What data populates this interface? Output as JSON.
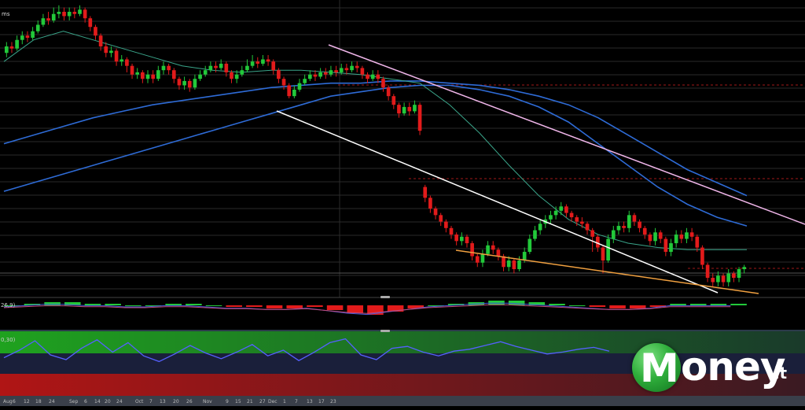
{
  "chart_data": [
    {
      "type": "candlestick",
      "title": "",
      "x_ticks": [
        "Aug",
        "6",
        "12",
        "18",
        "24",
        "Sep",
        "6",
        "14",
        "20",
        "24",
        "Oct",
        "7",
        "13",
        "20",
        "26",
        "Nov",
        "9",
        "15",
        "21",
        "27",
        "Dec",
        "1",
        "7",
        "13",
        "17",
        "23"
      ],
      "y_range": [
        0,
        100
      ],
      "grid": true,
      "candles": [
        {
          "o": 72,
          "c": 75,
          "h": 77,
          "l": 70
        },
        {
          "o": 75,
          "c": 74,
          "h": 77,
          "l": 72
        },
        {
          "o": 74,
          "c": 78,
          "h": 80,
          "l": 73
        },
        {
          "o": 78,
          "c": 80,
          "h": 82,
          "l": 76
        },
        {
          "o": 80,
          "c": 79,
          "h": 82,
          "l": 77
        },
        {
          "o": 79,
          "c": 82,
          "h": 84,
          "l": 78
        },
        {
          "o": 82,
          "c": 85,
          "h": 87,
          "l": 81
        },
        {
          "o": 85,
          "c": 88,
          "h": 90,
          "l": 84
        },
        {
          "o": 88,
          "c": 87,
          "h": 91,
          "l": 85
        },
        {
          "o": 87,
          "c": 90,
          "h": 93,
          "l": 86
        },
        {
          "o": 90,
          "c": 91,
          "h": 94,
          "l": 88
        },
        {
          "o": 91,
          "c": 89,
          "h": 93,
          "l": 87
        },
        {
          "o": 89,
          "c": 91,
          "h": 93,
          "l": 87
        },
        {
          "o": 91,
          "c": 90,
          "h": 93,
          "l": 88
        },
        {
          "o": 90,
          "c": 92,
          "h": 94,
          "l": 89
        },
        {
          "o": 92,
          "c": 88,
          "h": 93,
          "l": 86
        },
        {
          "o": 88,
          "c": 84,
          "h": 89,
          "l": 82
        },
        {
          "o": 84,
          "c": 80,
          "h": 85,
          "l": 78
        },
        {
          "o": 80,
          "c": 75,
          "h": 81,
          "l": 73
        },
        {
          "o": 75,
          "c": 72,
          "h": 77,
          "l": 70
        },
        {
          "o": 72,
          "c": 73,
          "h": 75,
          "l": 70
        },
        {
          "o": 73,
          "c": 68,
          "h": 74,
          "l": 66
        },
        {
          "o": 68,
          "c": 69,
          "h": 71,
          "l": 66
        },
        {
          "o": 69,
          "c": 66,
          "h": 70,
          "l": 63
        },
        {
          "o": 66,
          "c": 62,
          "h": 67,
          "l": 60
        },
        {
          "o": 62,
          "c": 63,
          "h": 65,
          "l": 60
        },
        {
          "o": 63,
          "c": 60,
          "h": 64,
          "l": 58
        },
        {
          "o": 60,
          "c": 62,
          "h": 64,
          "l": 58
        },
        {
          "o": 62,
          "c": 60,
          "h": 64,
          "l": 58
        },
        {
          "o": 60,
          "c": 64,
          "h": 66,
          "l": 59
        },
        {
          "o": 64,
          "c": 66,
          "h": 68,
          "l": 62
        },
        {
          "o": 66,
          "c": 64,
          "h": 67,
          "l": 62
        },
        {
          "o": 64,
          "c": 60,
          "h": 65,
          "l": 58
        },
        {
          "o": 60,
          "c": 57,
          "h": 61,
          "l": 55
        },
        {
          "o": 57,
          "c": 59,
          "h": 61,
          "l": 55
        },
        {
          "o": 59,
          "c": 56,
          "h": 60,
          "l": 54
        },
        {
          "o": 56,
          "c": 60,
          "h": 62,
          "l": 55
        },
        {
          "o": 60,
          "c": 62,
          "h": 64,
          "l": 59
        },
        {
          "o": 62,
          "c": 64,
          "h": 66,
          "l": 61
        },
        {
          "o": 64,
          "c": 66,
          "h": 68,
          "l": 63
        },
        {
          "o": 66,
          "c": 65,
          "h": 68,
          "l": 63
        },
        {
          "o": 65,
          "c": 67,
          "h": 69,
          "l": 64
        },
        {
          "o": 67,
          "c": 63,
          "h": 68,
          "l": 61
        },
        {
          "o": 63,
          "c": 60,
          "h": 64,
          "l": 58
        },
        {
          "o": 60,
          "c": 62,
          "h": 64,
          "l": 58
        },
        {
          "o": 62,
          "c": 64,
          "h": 66,
          "l": 61
        },
        {
          "o": 64,
          "c": 66,
          "h": 69,
          "l": 63
        },
        {
          "o": 66,
          "c": 68,
          "h": 71,
          "l": 65
        },
        {
          "o": 68,
          "c": 67,
          "h": 70,
          "l": 65
        },
        {
          "o": 67,
          "c": 69,
          "h": 71,
          "l": 66
        },
        {
          "o": 69,
          "c": 68,
          "h": 71,
          "l": 66
        },
        {
          "o": 68,
          "c": 64,
          "h": 69,
          "l": 62
        },
        {
          "o": 64,
          "c": 60,
          "h": 65,
          "l": 58
        },
        {
          "o": 60,
          "c": 57,
          "h": 61,
          "l": 55
        },
        {
          "o": 57,
          "c": 52,
          "h": 58,
          "l": 51
        },
        {
          "o": 52,
          "c": 55,
          "h": 57,
          "l": 51
        },
        {
          "o": 55,
          "c": 58,
          "h": 60,
          "l": 54
        },
        {
          "o": 58,
          "c": 60,
          "h": 62,
          "l": 57
        },
        {
          "o": 60,
          "c": 62,
          "h": 64,
          "l": 59
        },
        {
          "o": 62,
          "c": 61,
          "h": 64,
          "l": 59
        },
        {
          "o": 61,
          "c": 63,
          "h": 65,
          "l": 60
        },
        {
          "o": 63,
          "c": 62,
          "h": 65,
          "l": 60
        },
        {
          "o": 62,
          "c": 64,
          "h": 66,
          "l": 61
        },
        {
          "o": 64,
          "c": 63,
          "h": 66,
          "l": 61
        },
        {
          "o": 63,
          "c": 65,
          "h": 67,
          "l": 62
        },
        {
          "o": 65,
          "c": 64,
          "h": 67,
          "l": 62
        },
        {
          "o": 64,
          "c": 66,
          "h": 68,
          "l": 63
        },
        {
          "o": 66,
          "c": 65,
          "h": 68,
          "l": 63
        },
        {
          "o": 65,
          "c": 62,
          "h": 66,
          "l": 60
        },
        {
          "o": 62,
          "c": 60,
          "h": 63,
          "l": 58
        },
        {
          "o": 60,
          "c": 62,
          "h": 64,
          "l": 59
        },
        {
          "o": 62,
          "c": 60,
          "h": 64,
          "l": 58
        },
        {
          "o": 60,
          "c": 56,
          "h": 61,
          "l": 54
        },
        {
          "o": 56,
          "c": 52,
          "h": 57,
          "l": 50
        },
        {
          "o": 52,
          "c": 48,
          "h": 53,
          "l": 46
        },
        {
          "o": 48,
          "c": 44,
          "h": 49,
          "l": 42
        },
        {
          "o": 44,
          "c": 47,
          "h": 49,
          "l": 43
        },
        {
          "o": 47,
          "c": 45,
          "h": 49,
          "l": 43
        },
        {
          "o": 45,
          "c": 48,
          "h": 50,
          "l": 44
        },
        {
          "o": 48,
          "c": 36,
          "h": 49,
          "l": 34
        },
        {
          "o": 10,
          "c": 5,
          "h": 11,
          "l": 3
        },
        {
          "o": 5,
          "c": 0,
          "h": 6,
          "l": -2
        },
        {
          "o": 0,
          "c": -3,
          "h": 1,
          "l": -5
        },
        {
          "o": -3,
          "c": -6,
          "h": -2,
          "l": -8
        },
        {
          "o": -6,
          "c": -9,
          "h": -5,
          "l": -11
        },
        {
          "o": -9,
          "c": -12,
          "h": -8,
          "l": -14
        },
        {
          "o": -12,
          "c": -15,
          "h": -11,
          "l": -17
        },
        {
          "o": -15,
          "c": -13,
          "h": -11,
          "l": -17
        },
        {
          "o": -13,
          "c": -16,
          "h": -12,
          "l": -18
        },
        {
          "o": -16,
          "c": -22,
          "h": -15,
          "l": -24
        },
        {
          "o": -22,
          "c": -25,
          "h": -21,
          "l": -27
        },
        {
          "o": -25,
          "c": -21,
          "h": -19,
          "l": -27
        },
        {
          "o": -21,
          "c": -17,
          "h": -15,
          "l": -22
        },
        {
          "o": -17,
          "c": -19,
          "h": -15,
          "l": -21
        },
        {
          "o": -19,
          "c": -22,
          "h": -18,
          "l": -24
        },
        {
          "o": -22,
          "c": -27,
          "h": -21,
          "l": -29
        },
        {
          "o": -27,
          "c": -24,
          "h": -22,
          "l": -29
        },
        {
          "o": -24,
          "c": -28,
          "h": -23,
          "l": -30
        },
        {
          "o": -28,
          "c": -24,
          "h": -22,
          "l": -29
        },
        {
          "o": -24,
          "c": -20,
          "h": -18,
          "l": -25
        },
        {
          "o": -20,
          "c": -14,
          "h": -12,
          "l": -21
        },
        {
          "o": -14,
          "c": -10,
          "h": -8,
          "l": -15
        },
        {
          "o": -10,
          "c": -7,
          "h": -5,
          "l": -12
        },
        {
          "o": -7,
          "c": -5,
          "h": -3,
          "l": -9
        },
        {
          "o": -5,
          "c": -3,
          "h": -1,
          "l": -7
        },
        {
          "o": -3,
          "c": -1,
          "h": 1,
          "l": -5
        },
        {
          "o": -1,
          "c": 1,
          "h": 3,
          "l": -3
        },
        {
          "o": 1,
          "c": -2,
          "h": 2,
          "l": -4
        },
        {
          "o": -2,
          "c": -4,
          "h": -1,
          "l": -6
        },
        {
          "o": -4,
          "c": -6,
          "h": -3,
          "l": -8
        },
        {
          "o": -6,
          "c": -7,
          "h": -4,
          "l": -9
        },
        {
          "o": -7,
          "c": -10,
          "h": -6,
          "l": -12
        },
        {
          "o": -10,
          "c": -13,
          "h": -9,
          "l": -20
        },
        {
          "o": -13,
          "c": -18,
          "h": -12,
          "l": -20
        },
        {
          "o": -18,
          "c": -24,
          "h": -17,
          "l": -30
        },
        {
          "o": -24,
          "c": -14,
          "h": -12,
          "l": -25
        },
        {
          "o": -14,
          "c": -10,
          "h": -8,
          "l": -16
        },
        {
          "o": -10,
          "c": -8,
          "h": -6,
          "l": -12
        },
        {
          "o": -8,
          "c": -9,
          "h": -6,
          "l": -11
        },
        {
          "o": -9,
          "c": -3,
          "h": -1,
          "l": -11
        },
        {
          "o": -3,
          "c": -6,
          "h": -2,
          "l": -8
        },
        {
          "o": -6,
          "c": -9,
          "h": -5,
          "l": -11
        },
        {
          "o": -9,
          "c": -12,
          "h": -8,
          "l": -14
        },
        {
          "o": -12,
          "c": -15,
          "h": -11,
          "l": -17
        },
        {
          "o": -15,
          "c": -11,
          "h": -9,
          "l": -17
        },
        {
          "o": -11,
          "c": -14,
          "h": -10,
          "l": -16
        },
        {
          "o": -14,
          "c": -20,
          "h": -13,
          "l": -22
        },
        {
          "o": -20,
          "c": -16,
          "h": -14,
          "l": -22
        },
        {
          "o": -16,
          "c": -12,
          "h": -10,
          "l": -18
        },
        {
          "o": -12,
          "c": -14,
          "h": -10,
          "l": -16
        },
        {
          "o": -14,
          "c": -11,
          "h": -9,
          "l": -16
        },
        {
          "o": -11,
          "c": -13,
          "h": -9,
          "l": -15
        },
        {
          "o": -13,
          "c": -18,
          "h": -12,
          "l": -20
        },
        {
          "o": -18,
          "c": -26,
          "h": -17,
          "l": -28
        },
        {
          "o": -26,
          "c": -32,
          "h": -25,
          "l": -34
        },
        {
          "o": -32,
          "c": -34,
          "h": -30,
          "l": -36
        },
        {
          "o": -34,
          "c": -31,
          "h": -29,
          "l": -36
        },
        {
          "o": -31,
          "c": -34,
          "h": -30,
          "l": -36
        },
        {
          "o": -34,
          "c": -30,
          "h": -28,
          "l": -36
        },
        {
          "o": -30,
          "c": -32,
          "h": -29,
          "l": -34
        },
        {
          "o": -32,
          "c": -28,
          "h": -27,
          "l": -34
        },
        {
          "o": -28,
          "c": -27,
          "h": -26,
          "l": -30
        }
      ],
      "moving_averages": [
        {
          "color": "#2e6bd6",
          "values": [
            30,
            34,
            38,
            42,
            45,
            48,
            50,
            52,
            54,
            56,
            57,
            58,
            58,
            59,
            59,
            58,
            57,
            55,
            52,
            48,
            42,
            34,
            26,
            18,
            12,
            6
          ]
        },
        {
          "color": "#2e6bd6",
          "values": [
            8,
            12,
            16,
            20,
            24,
            28,
            32,
            36,
            40,
            44,
            48,
            52,
            54,
            56,
            57,
            57,
            55,
            52,
            47,
            40,
            30,
            20,
            10,
            2,
            -4,
            -8
          ]
        },
        {
          "color": "#3aa58a",
          "values": [
            68,
            78,
            82,
            78,
            74,
            70,
            66,
            64,
            63,
            64,
            64,
            63,
            62,
            60,
            58,
            48,
            35,
            20,
            6,
            -5,
            -12,
            -16,
            -18,
            -19,
            -19,
            -19
          ]
        }
      ],
      "trendlines": [
        {
          "name": "",
          "color": "#f0b6ea"
        },
        {
          "name": "",
          "color": "#ffffff"
        },
        {
          "name": "",
          "color": "#f0a040"
        }
      ],
      "panels": [
        {
          "type": "histogram",
          "label": "26,9)",
          "values": [
            0,
            1,
            2,
            2,
            1,
            1,
            0,
            0,
            1,
            1,
            0,
            -1,
            -1,
            -2,
            -2,
            -1,
            -3,
            -5,
            -6,
            -4,
            -2,
            0,
            1,
            2,
            3,
            3,
            2,
            1,
            0,
            -1,
            -2,
            -2,
            -1,
            1,
            1,
            1,
            1
          ]
        },
        {
          "type": "line",
          "label": "0,30)",
          "values": [
            42,
            50,
            60,
            45,
            40,
            52,
            61,
            48,
            58,
            44,
            38,
            46,
            55,
            47,
            41,
            48,
            56,
            44,
            50,
            39,
            48,
            58,
            62,
            45,
            40,
            52,
            54,
            48,
            44,
            49,
            51,
            55,
            59,
            54,
            50,
            46,
            48,
            51,
            53,
            49
          ]
        }
      ]
    }
  ],
  "header": {
    "left_label": "ms"
  },
  "logo": {
    "initial": "M",
    "rest": "oney",
    "tld": ".it",
    "ball_color": "#2fae3b"
  }
}
